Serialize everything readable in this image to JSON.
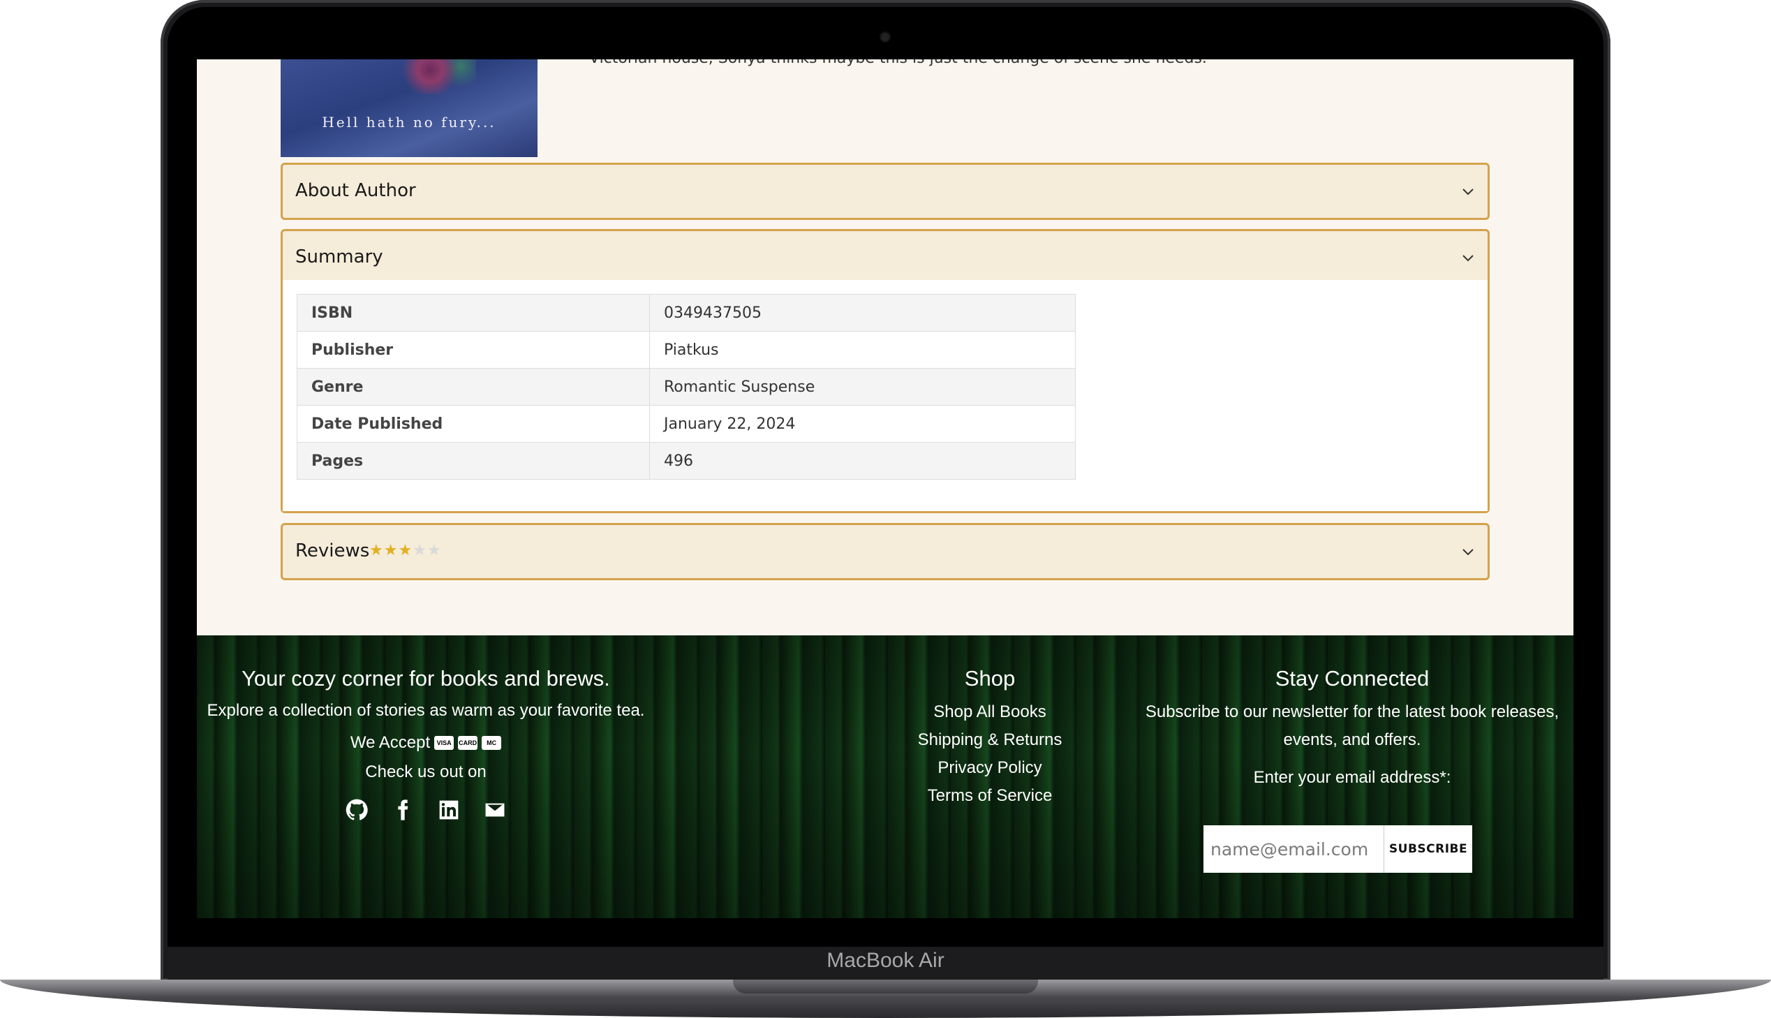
{
  "device": {
    "label": "MacBook Air"
  },
  "cover": {
    "tagline": "Hell hath no fury..."
  },
  "description": {
    "cutoff_text": "Victorian house, Sonya thinks maybe this is just the change of scene she needs."
  },
  "accordion": {
    "about_author": {
      "title": "About Author"
    },
    "summary": {
      "title": "Summary",
      "rows": [
        {
          "key": "ISBN",
          "value": "0349437505"
        },
        {
          "key": "Publisher",
          "value": "Piatkus"
        },
        {
          "key": "Genre",
          "value": "Romantic Suspense"
        },
        {
          "key": "Date Published",
          "value": "January 22, 2024"
        },
        {
          "key": "Pages",
          "value": "496"
        }
      ]
    },
    "reviews": {
      "title": "Reviews",
      "rating": 3,
      "rating_max": 5
    }
  },
  "footer": {
    "col1": {
      "heading": "Your cozy corner for books and brews.",
      "text": "Explore a collection of stories as warm as your favorite tea.",
      "accept_label": "We Accept",
      "cards": [
        "VISA",
        "CARD",
        "MC"
      ],
      "check_label": "Check us out on",
      "social": [
        "github-icon",
        "facebook-icon",
        "linkedin-icon",
        "envelope-icon"
      ]
    },
    "col2": {
      "heading": "Shop",
      "links": [
        "Shop All Books",
        "Shipping & Returns",
        "Privacy Policy",
        "Terms of Service"
      ]
    },
    "col3": {
      "heading": "Stay Connected",
      "text_line1": "Subscribe to our newsletter for the latest book releases,",
      "text_line2": "events, and offers.",
      "email_label": "Enter your email address*:",
      "email_placeholder": "name@email.com",
      "subscribe_label": "SUBSCRIBE"
    }
  },
  "colors": {
    "accent": "#d4a24c",
    "star": "#e3b021",
    "header_bg": "#f5ecd9",
    "page_bg": "#faf6ef"
  }
}
